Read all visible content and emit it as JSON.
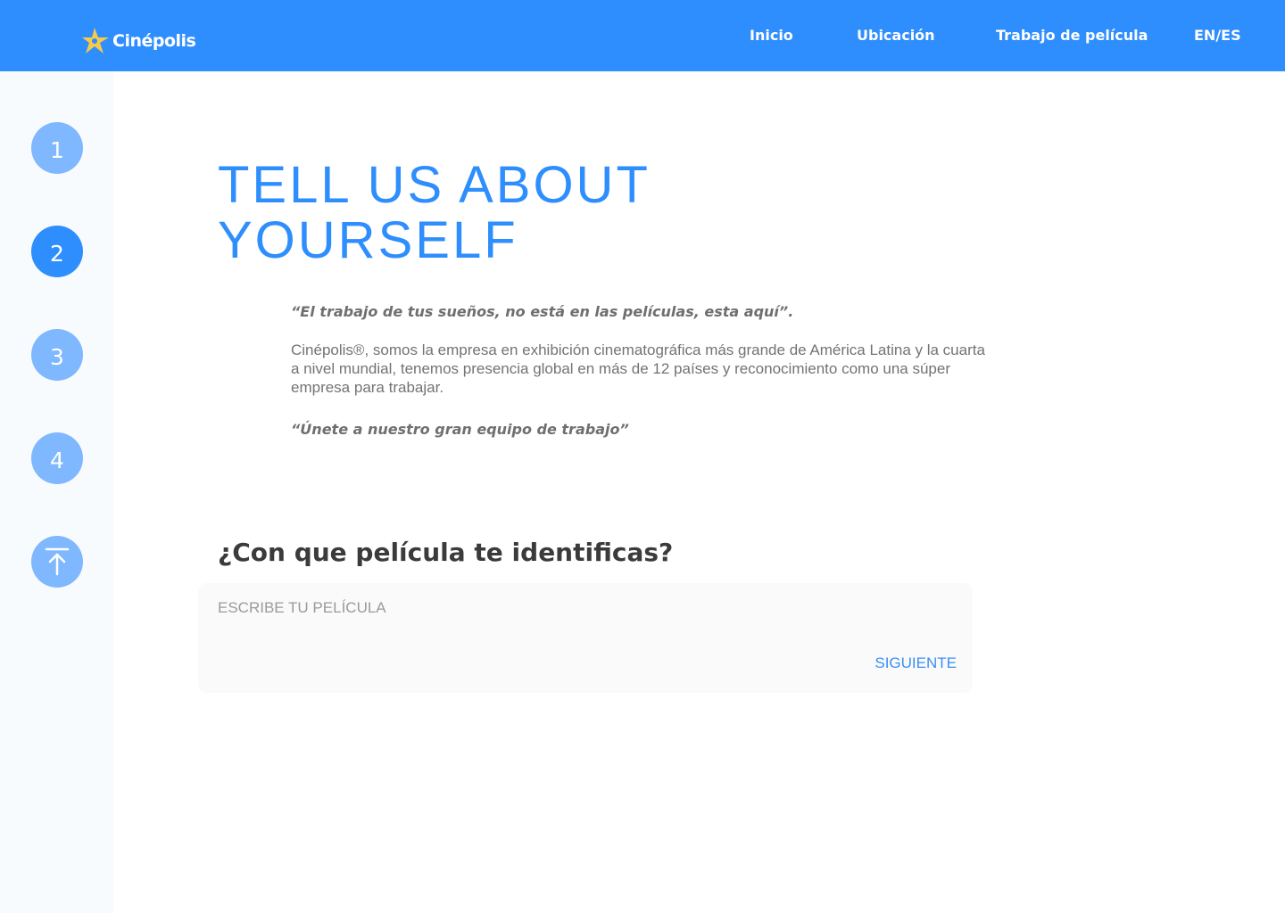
{
  "brand": {
    "name": "Cinépolis",
    "primary_color": "#2f8efd",
    "logo_star_color": "#f7c948"
  },
  "nav": {
    "items": [
      {
        "label": "Inicio"
      },
      {
        "label": "Ubicación"
      },
      {
        "label": "Trabajo de película"
      },
      {
        "label": "EN/ES"
      }
    ]
  },
  "steps": {
    "items": [
      {
        "label": "1",
        "active": false
      },
      {
        "label": "2",
        "active": true
      },
      {
        "label": "3",
        "active": false
      },
      {
        "label": "4",
        "active": false
      }
    ],
    "back_to_top_icon": "arrow-up-to-line-icon"
  },
  "main": {
    "title": "TELL US ABOUT YOURSELF",
    "quote_1": "“El trabajo de tus sueños, no está en las películas, esta aquí”.",
    "description": "Cinépolis®, somos la empresa en exhibición cinematográfica más grande de América Latina y la cuarta a nivel mundial, tenemos presencia global en más de 12 países y reconocimiento como una súper empresa para trabajar.",
    "quote_2": "“Únete a nuestro gran equipo de trabajo”",
    "question": "¿Con que película te identificas?",
    "input_placeholder": "ESCRIBE TU PELÍCULA",
    "input_value": "",
    "next_label": "SIGUIENTE"
  }
}
